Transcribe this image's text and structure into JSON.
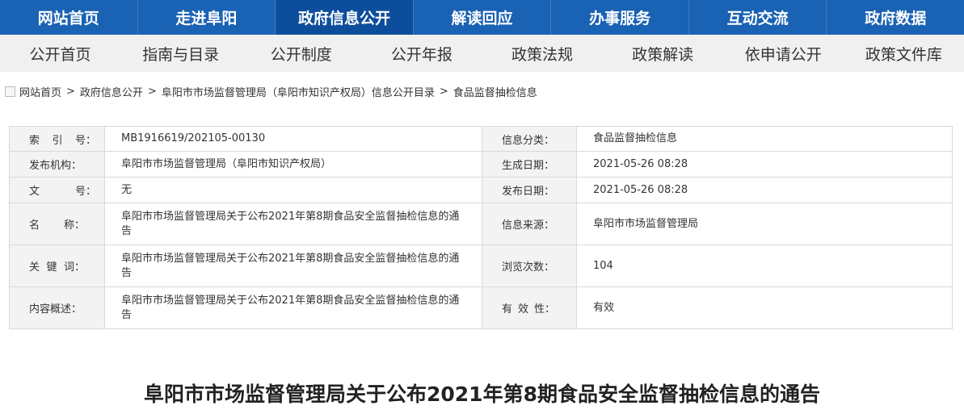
{
  "top_nav": [
    "网站首页",
    "走进阜阳",
    "政府信息公开",
    "解读回应",
    "办事服务",
    "互动交流",
    "政府数据"
  ],
  "sub_nav": [
    "公开首页",
    "指南与目录",
    "公开制度",
    "公开年报",
    "政策法规",
    "政策解读",
    "依申请公开",
    "政策文件库"
  ],
  "breadcrumb": {
    "items": [
      "网站首页",
      "政府信息公开",
      "阜阳市市场监督管理局（阜阳市知识产权局）信息公开目录",
      "食品监督抽检信息"
    ],
    "separator": ">"
  },
  "info": {
    "index_no_label": [
      "索",
      "引",
      "号："
    ],
    "index_no": "MB1916619/202105-00130",
    "category_label": "信息分类：",
    "category": "食品监督抽检信息",
    "publisher_label": "发布机构：",
    "publisher": "阜阳市市场监督管理局（阜阳市知识产权局）",
    "created_label": "生成日期：",
    "created": "2021-05-26 08:28",
    "doc_no_label": [
      "文",
      "号："
    ],
    "doc_no": "无",
    "published_label": "发布日期：",
    "published": "2021-05-26 08:28",
    "name_label": [
      "名",
      "称："
    ],
    "name": "阜阳市市场监督管理局关于公布2021年第8期食品安全监督抽检信息的通告",
    "source_label": "信息来源：",
    "source": "阜阳市市场监督管理局",
    "keywords_label": [
      "关",
      "键",
      "词："
    ],
    "keywords": "阜阳市市场监督管理局关于公布2021年第8期食品安全监督抽检信息的通告",
    "views_label": "浏览次数：",
    "views": "104",
    "summary_label": "内容概述：",
    "summary": "阜阳市市场监督管理局关于公布2021年第8期食品安全监督抽检信息的通告",
    "validity_label": [
      "有",
      "效",
      "性："
    ],
    "validity": "有效"
  },
  "page_title": "阜阳市市场监督管理局关于公布2021年第8期食品安全监督抽检信息的通告"
}
